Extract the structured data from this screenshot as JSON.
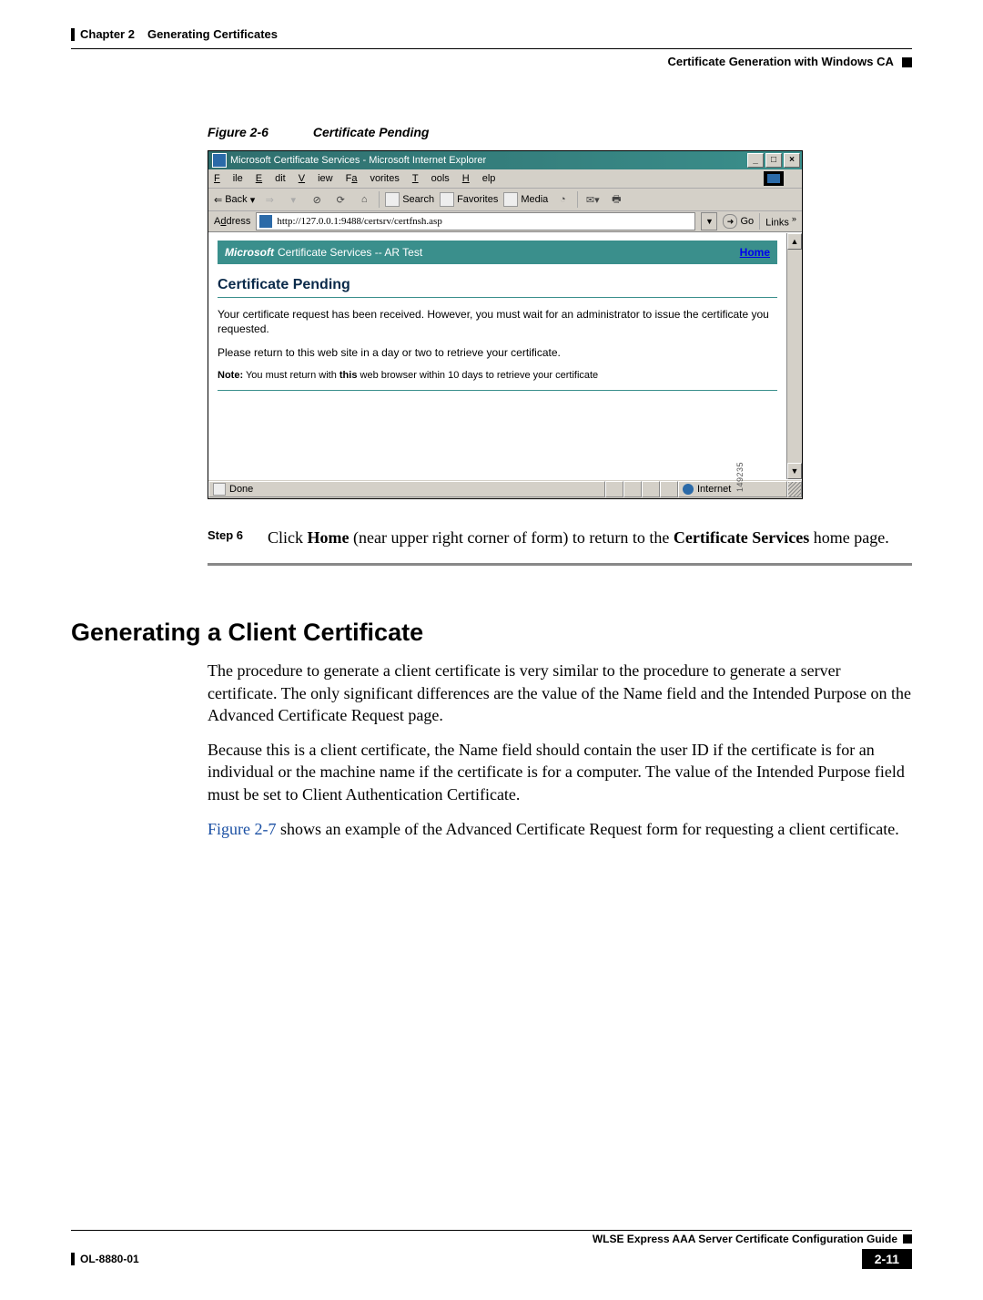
{
  "header": {
    "chapter": "Chapter 2",
    "title": "Generating Certificates",
    "right": "Certificate Generation with Windows CA"
  },
  "figure": {
    "label": "Figure 2-6",
    "caption": "Certificate Pending",
    "id_label": "149235"
  },
  "ie_window": {
    "title": "Microsoft Certificate Services - Microsoft Internet Explorer",
    "window_buttons": {
      "min": "_",
      "max": "□",
      "close": "×"
    },
    "menubar": [
      "File",
      "Edit",
      "View",
      "Favorites",
      "Tools",
      "Help"
    ],
    "toolbar": {
      "back": "Back",
      "search": "Search",
      "favorites": "Favorites",
      "media": "Media"
    },
    "address_label": "Address",
    "address_url": "http://127.0.0.1:9488/certsrv/certfnsh.asp",
    "go_label": "Go",
    "links_label": "Links",
    "service_head_brand": "Microsoft",
    "service_head_text": " Certificate Services  --  AR Test",
    "home_link": "Home",
    "page_heading": "Certificate Pending",
    "para1": "Your certificate request has been received. However, you must wait for an administrator to issue the certificate you requested.",
    "para2": "Please return to this web site in a day or two to retrieve your certificate.",
    "note_prefix": "Note:",
    "note_mid1": " You must return with ",
    "note_bold": "this",
    "note_mid2": " web browser within 10 days to retrieve your certificate",
    "status_done": "Done",
    "status_zone": "Internet"
  },
  "step": {
    "num": "Step 6",
    "text_pre": "Click ",
    "text_b1": "Home",
    "text_mid": " (near upper right corner of form) to return to the ",
    "text_b2": "Certificate Services",
    "text_post": " home page."
  },
  "section": {
    "heading": "Generating a Client Certificate",
    "p1": "The procedure to generate a client certificate is very similar to the procedure to generate a server certificate. The only significant differences are the value of the Name field and the Intended Purpose on the Advanced Certificate Request page.",
    "p2": "Because this is a client certificate, the Name field should contain the user ID if the certificate is for an individual or the machine name if the certificate is for a computer. The value of the Intended Purpose field must be set to Client Authentication Certificate.",
    "p3_link": "Figure 2-7",
    "p3_rest": " shows an example of the Advanced Certificate Request form for requesting a client certificate."
  },
  "footer": {
    "guide": "WLSE Express AAA Server Certificate Configuration Guide",
    "docnum": "OL-8880-01",
    "page": "2-11"
  }
}
